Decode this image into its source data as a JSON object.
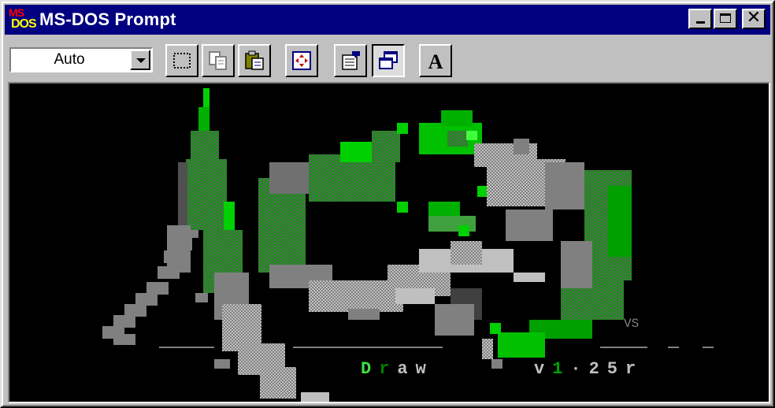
{
  "window": {
    "title": "MS-DOS Prompt",
    "icon": "ms-dos-icon",
    "icon_text_top": "MS",
    "icon_text_bottom": "DOS",
    "controls": [
      "minimize-icon",
      "maximize-icon",
      "close-icon"
    ]
  },
  "toolbar": {
    "font_size_value": "Auto",
    "buttons": [
      {
        "name": "mark-button",
        "icon": "mark-icon"
      },
      {
        "name": "copy-button",
        "icon": "copy-icon"
      },
      {
        "name": "paste-button",
        "icon": "paste-icon"
      },
      {
        "name": "full-screen-button",
        "icon": "full-screen-icon"
      },
      {
        "name": "properties-button",
        "icon": "properties-icon"
      },
      {
        "name": "background-button",
        "icon": "background-icon",
        "pressed": true
      },
      {
        "name": "font-button",
        "icon": "font-icon",
        "label": "A"
      }
    ]
  },
  "console": {
    "background": "#000000",
    "tagline_word1_a": "D",
    "tagline_word1_b": "r",
    "tagline_word1_c": "aw",
    "tagline_version_a": "v",
    "tagline_version_b": "1",
    "tagline_version_c": "·25r",
    "signature": "VS",
    "colors": {
      "bright_green": "#00d000",
      "dark_green": "#008000",
      "gray": "#808080",
      "light_gray": "#c0c0c0",
      "text_green": "#40e040"
    }
  }
}
